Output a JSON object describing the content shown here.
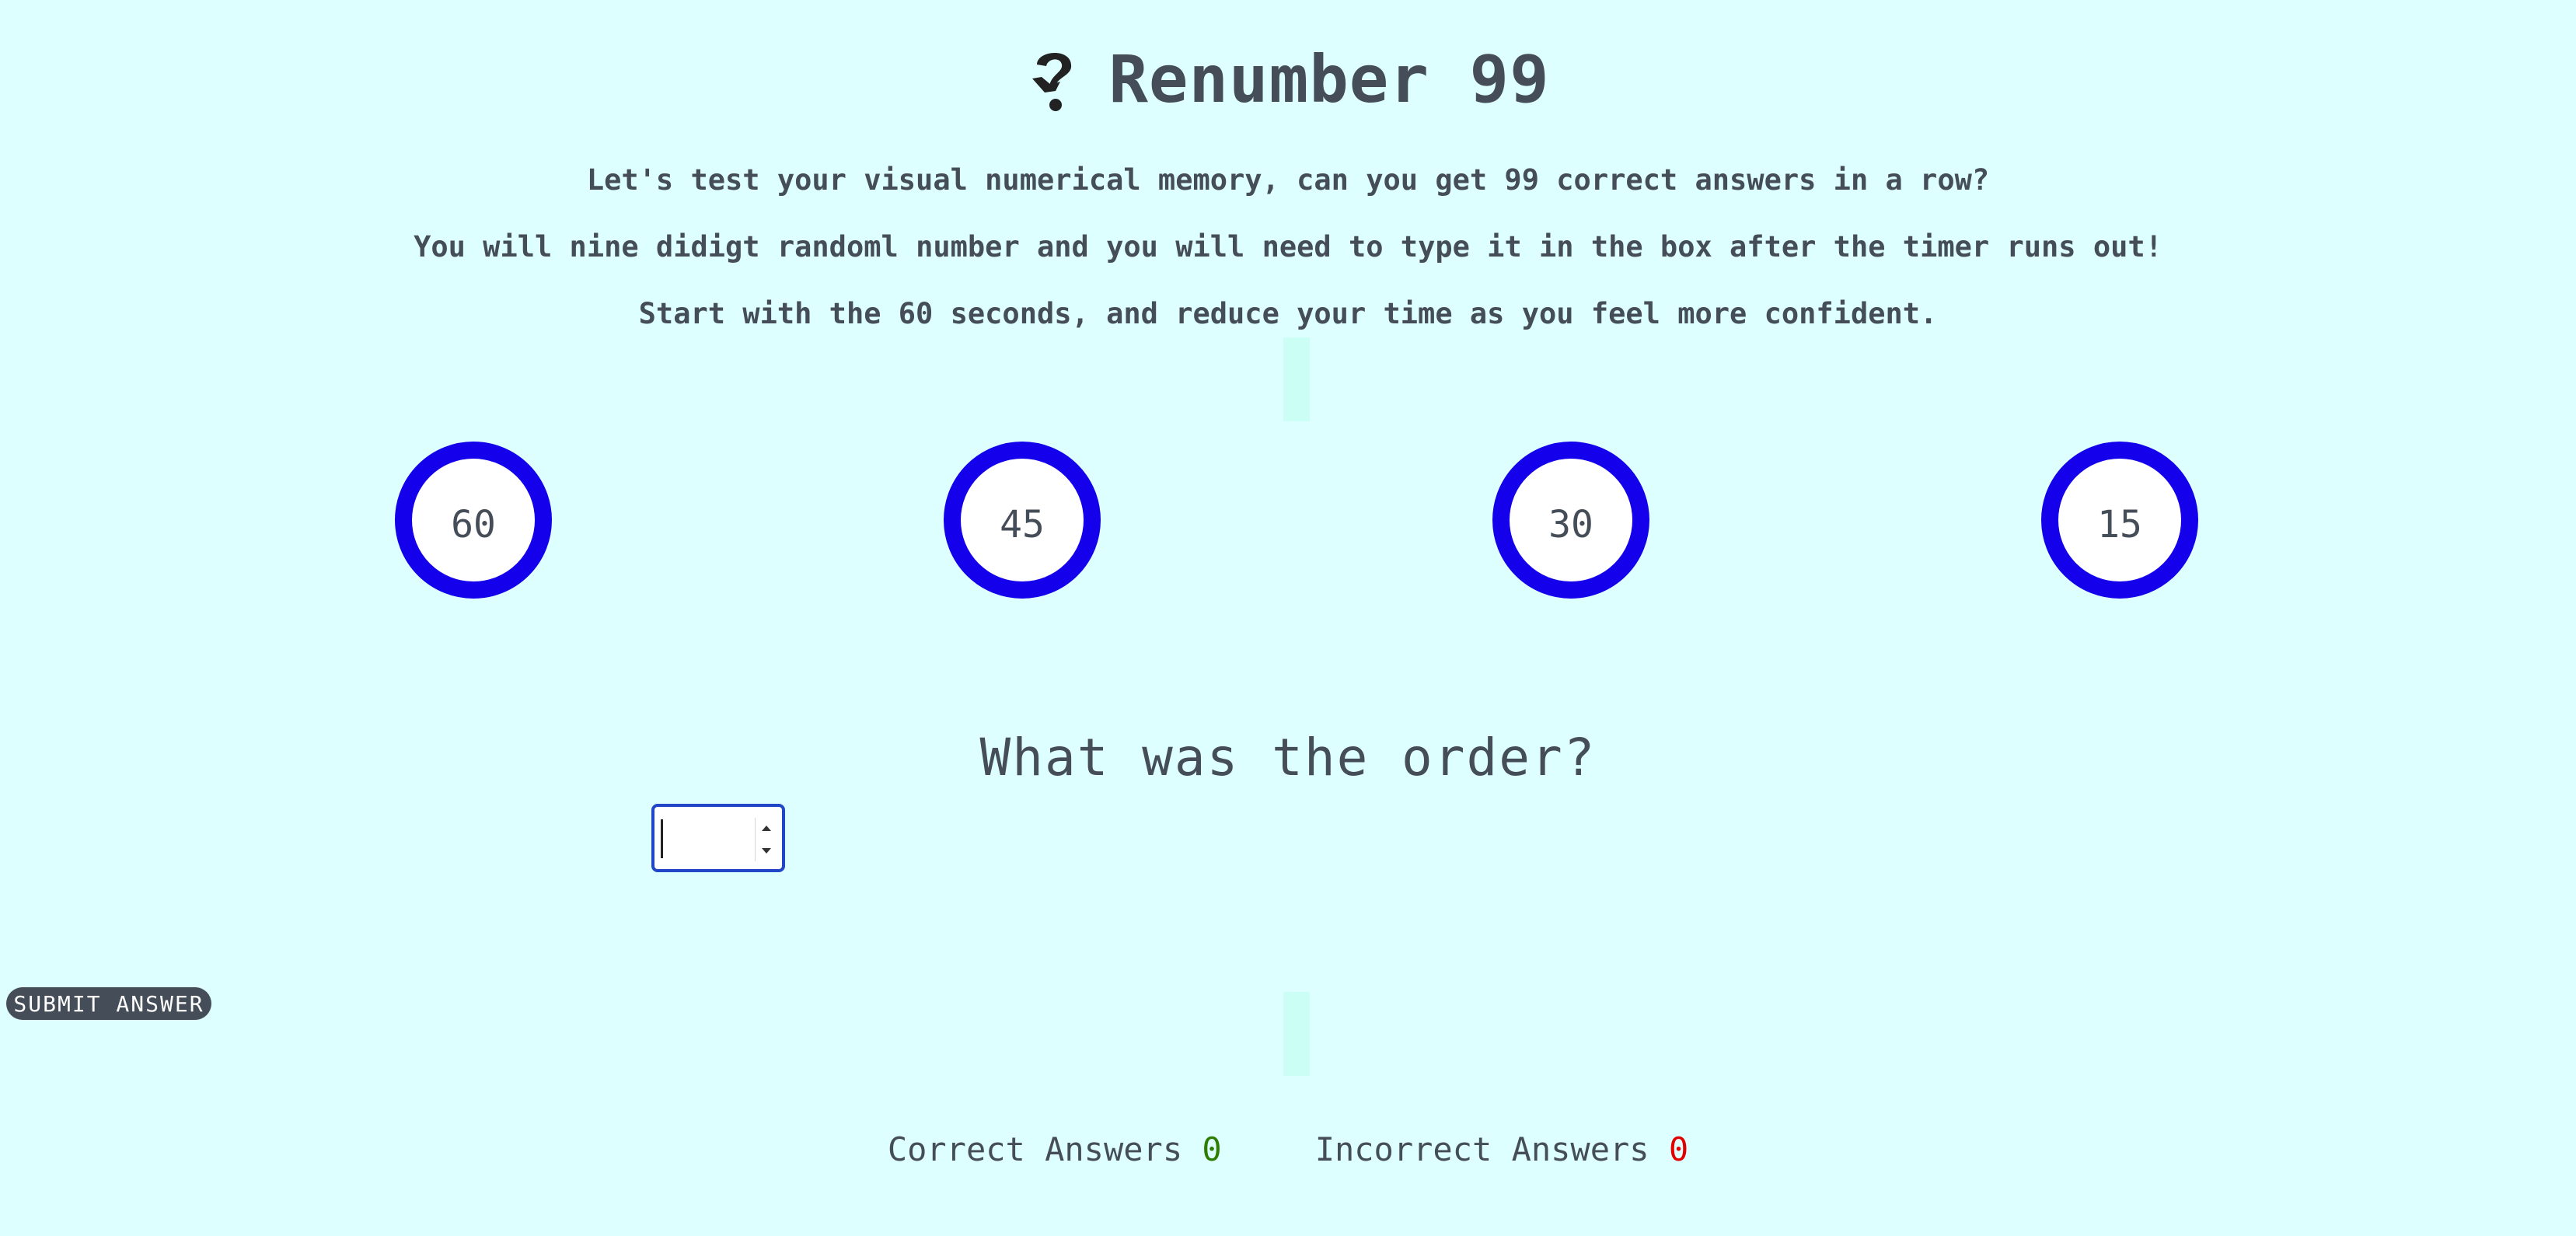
{
  "title": {
    "icon": "question-mark-icon",
    "text": "Renumber 99"
  },
  "intro": {
    "line1": "Let's test your visual numerical memory, can you get 99 correct answers in a row?",
    "line2": "You will nine didigt randoml number and you will need to type it in the box after the timer runs out!",
    "line3": "Start with the 60 seconds, and reduce your time as you feel more confident."
  },
  "timers": [
    {
      "label": "60"
    },
    {
      "label": "45"
    },
    {
      "label": "30"
    },
    {
      "label": "15"
    }
  ],
  "question": "What was the order?",
  "answer": {
    "value": "",
    "placeholder": ""
  },
  "submit_label": "SUBMIT ANSWER",
  "scores": {
    "correct_label": "Correct Answers",
    "correct_value": "0",
    "incorrect_label": "Incorrect Answers",
    "incorrect_value": "0"
  },
  "colors": {
    "background": "#deffff",
    "timer_ring": "#1400ea",
    "text": "#454e58",
    "correct": "#2e7d00",
    "incorrect": "#e30000",
    "button": "#454e58"
  }
}
